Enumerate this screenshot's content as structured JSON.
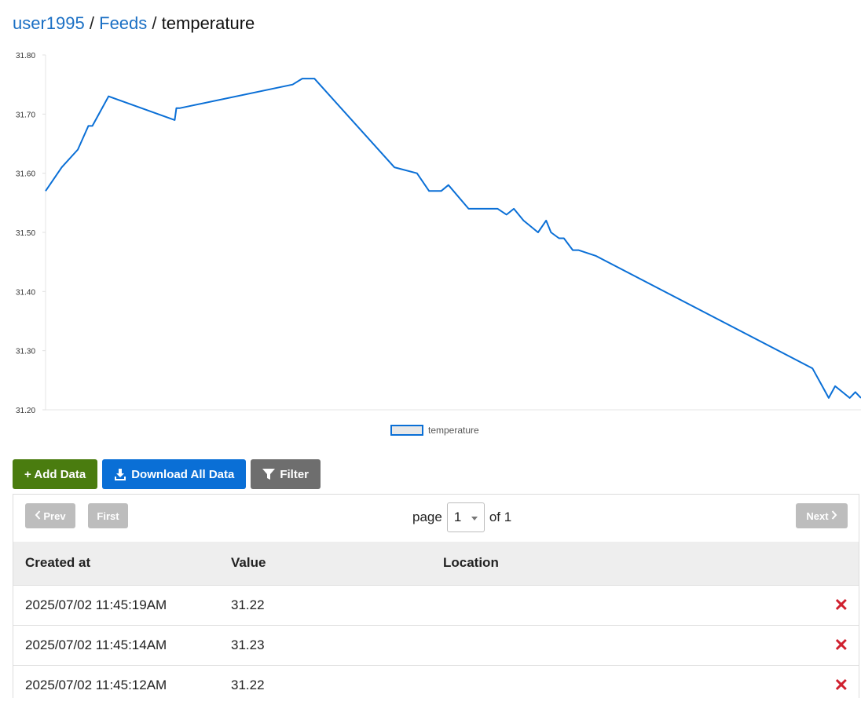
{
  "breadcrumb": {
    "user": "user1995",
    "feeds": "Feeds",
    "feed": "temperature",
    "separator": "/"
  },
  "chart_data": {
    "type": "line",
    "title": "",
    "xlabel": "",
    "ylabel": "",
    "ylim": [
      31.2,
      31.8
    ],
    "yticks": [
      "31.80",
      "31.70",
      "31.60",
      "31.50",
      "31.40",
      "31.30",
      "31.20"
    ],
    "legend": "bottom-center",
    "series": [
      {
        "name": "temperature",
        "color": "#0a6fd6",
        "x": [
          0,
          2,
          4,
          5.3,
          5.8,
          7.8,
          16,
          16.2,
          16.6,
          30.6,
          31.8,
          33.3,
          43.2,
          46,
          47.5,
          49,
          49.9,
          52.4,
          56,
          57.1,
          58,
          59.2,
          61,
          62,
          62.6,
          63.6,
          64.2,
          65.3,
          66,
          68.2,
          95,
          96.2,
          97,
          97.8,
          98.7,
          99.6,
          100.3,
          101
        ],
        "values": [
          31.57,
          31.61,
          31.64,
          31.68,
          31.68,
          31.73,
          31.69,
          31.71,
          31.71,
          31.75,
          31.76,
          31.76,
          31.61,
          31.6,
          31.57,
          31.57,
          31.58,
          31.54,
          31.54,
          31.53,
          31.54,
          31.52,
          31.5,
          31.52,
          31.5,
          31.49,
          31.49,
          31.47,
          31.47,
          31.46,
          31.27,
          31.24,
          31.22,
          31.24,
          31.23,
          31.22,
          31.23,
          31.22
        ]
      }
    ]
  },
  "actions": {
    "add": "+ Add Data",
    "download": "Download All Data",
    "filter": "Filter"
  },
  "pager": {
    "prev": "Prev",
    "first": "First",
    "next": "Next",
    "page_label": "page",
    "page_value": "1",
    "of_label": "of 1"
  },
  "table": {
    "headers": {
      "created": "Created at",
      "value": "Value",
      "location": "Location"
    },
    "rows": [
      {
        "created": "2025/07/02 11:45:19AM",
        "value": "31.22",
        "location": ""
      },
      {
        "created": "2025/07/02 11:45:14AM",
        "value": "31.23",
        "location": ""
      },
      {
        "created": "2025/07/02 11:45:12AM",
        "value": "31.22",
        "location": ""
      }
    ],
    "delete_glyph": "✕"
  },
  "colors": {
    "link": "#1a6fc4",
    "add": "#4a7c0f",
    "download": "#0a6fd6",
    "filter": "#6e6e6e",
    "delete": "#d0212f"
  }
}
